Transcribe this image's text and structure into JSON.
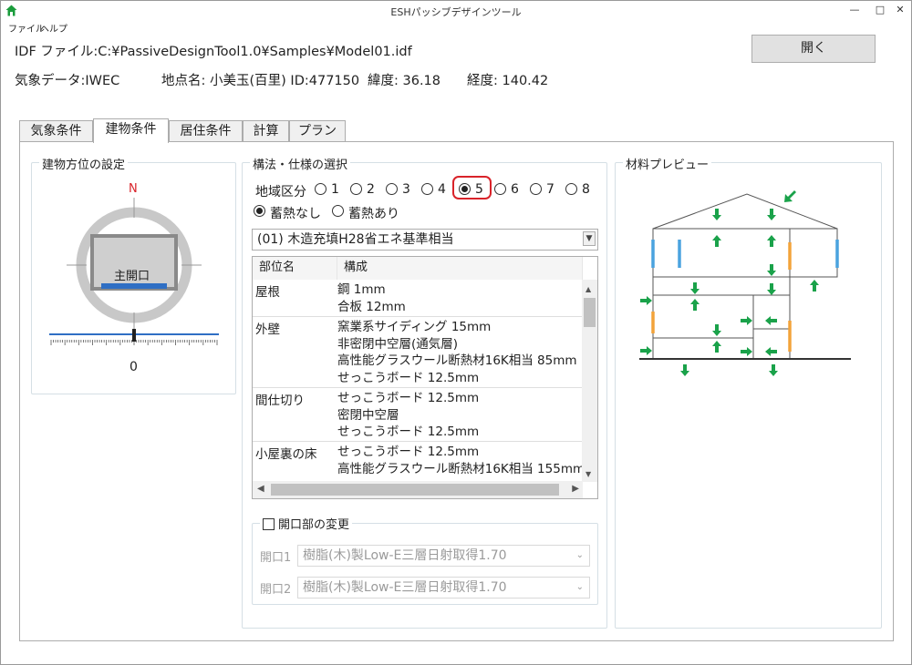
{
  "window": {
    "title": "ESHパッシブデザインツール"
  },
  "menu": {
    "file": "ファイル",
    "help": "ヘルプ"
  },
  "info": {
    "idf_label": "IDF ファイル:",
    "idf_path": "C:¥PassiveDesignTool1.0¥Samples¥Model01.idf",
    "weather_label": "気象データ:",
    "weather_value": "IWEC",
    "location": "地点名: 小美玉(百里) ID:477150",
    "lat": "緯度: 36.18",
    "lon": "経度: 140.42"
  },
  "open_button": "開く",
  "tabs": [
    {
      "label": "気象条件"
    },
    {
      "label": "建物条件"
    },
    {
      "label": "居住条件"
    },
    {
      "label": "計算"
    },
    {
      "label": "プラン"
    }
  ],
  "orientation": {
    "title": "建物方位の設定",
    "north": "N",
    "main_opening": "主開口",
    "angle": "0"
  },
  "construction": {
    "title": "構法・仕様の選択",
    "region_label": "地域区分",
    "regions": [
      "1",
      "2",
      "3",
      "4",
      "5",
      "6",
      "7",
      "8"
    ],
    "selected_region": "5",
    "storage_none": "蓄熱なし",
    "storage_yes": "蓄熱あり",
    "spec_value": "(01) 木造充填H28省エネ基準相当",
    "table_headers": [
      "部位名",
      "構成"
    ],
    "rows": [
      {
        "part": "屋根",
        "layers": [
          "鋼 1mm",
          "合板 12mm"
        ]
      },
      {
        "part": "外壁",
        "layers": [
          "窯業系サイディング 15mm",
          "非密閉中空層(通気層)",
          "高性能グラスウール断熱材16K相当 85mm",
          "せっこうボード 12.5mm"
        ]
      },
      {
        "part": "間仕切り",
        "layers": [
          "せっこうボード 12.5mm",
          "密閉中空層",
          "せっこうボード 12.5mm"
        ]
      },
      {
        "part": "小屋裏の床",
        "layers": [
          "せっこうボード 12.5mm",
          "高性能グラスウール断熱材16K相当 155mm"
        ]
      }
    ],
    "opening_change": "開口部の変更",
    "opening1_label": "開口1",
    "opening1_value": "樹脂(木)製Low-E三層日射取得1.70",
    "opening2_label": "開口2",
    "opening2_value": "樹脂(木)製Low-E三層日射取得1.70"
  },
  "preview": {
    "title": "材料プレビュー"
  },
  "colors": {
    "accent_red": "#d9232a",
    "blue": "#2f6fc4",
    "green": "#1aa24a",
    "orange": "#f2a33a",
    "light_blue": "#4aa3df"
  }
}
